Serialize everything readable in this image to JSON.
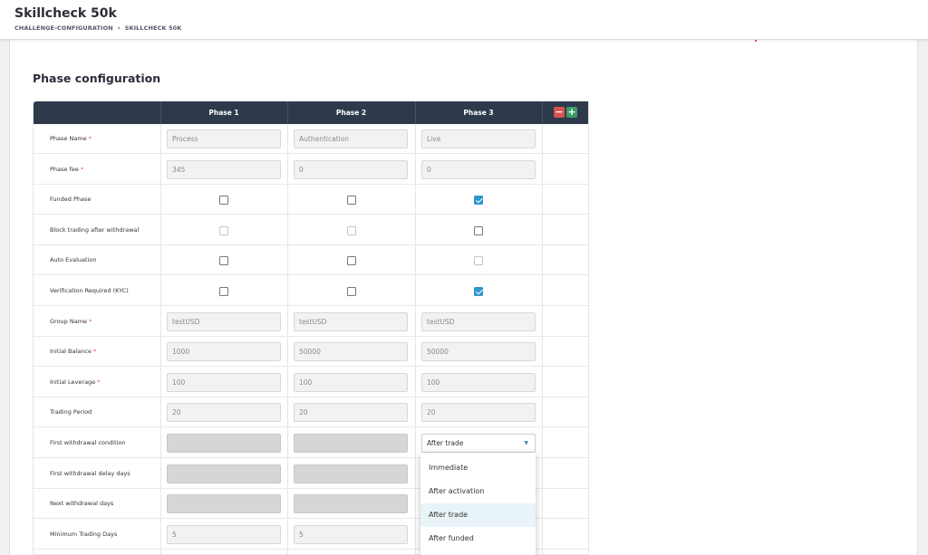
{
  "header": {
    "title": "Skillcheck 50k",
    "breadcrumb": [
      "CHALLENGE-CONFIGURATION",
      "SKILLCHECK 50K"
    ],
    "breadcrumb_sep": "›"
  },
  "section": {
    "title": "Phase configuration"
  },
  "table": {
    "columns": [
      "Phase 1",
      "Phase 2",
      "Phase 3"
    ],
    "minus_label": "−",
    "plus_label": "+",
    "rows": [
      {
        "label": "Phase Name",
        "required": true,
        "type": "text",
        "values": [
          "Process",
          "Authentication",
          "Live"
        ]
      },
      {
        "label": "Phase fee",
        "required": true,
        "type": "text",
        "values": [
          "345",
          "0",
          "0"
        ]
      },
      {
        "label": "Funded Phase",
        "required": false,
        "type": "checkbox",
        "checked": [
          false,
          false,
          true
        ],
        "dim": [
          false,
          false,
          false
        ]
      },
      {
        "label": "Block trading after withdrawal",
        "required": false,
        "type": "checkbox",
        "checked": [
          false,
          false,
          false
        ],
        "dim": [
          true,
          true,
          false
        ]
      },
      {
        "label": "Auto Evaluation",
        "required": false,
        "type": "checkbox",
        "checked": [
          false,
          false,
          false
        ],
        "dim": [
          false,
          false,
          true
        ]
      },
      {
        "label": "Verification Required (KYC)",
        "required": false,
        "type": "checkbox",
        "checked": [
          false,
          false,
          true
        ],
        "dim": [
          false,
          false,
          false
        ]
      },
      {
        "label": "Group Name",
        "required": true,
        "type": "text",
        "values": [
          "testUSD",
          "testUSD",
          "testUSD"
        ]
      },
      {
        "label": "Initial Balance",
        "required": true,
        "type": "text",
        "values": [
          "1000",
          "50000",
          "50000"
        ]
      },
      {
        "label": "Initial Leverage",
        "required": true,
        "type": "text",
        "values": [
          "100",
          "100",
          "100"
        ]
      },
      {
        "label": "Trading Period",
        "required": false,
        "type": "text",
        "values": [
          "20",
          "20",
          "20"
        ]
      },
      {
        "label": "First withdrawal condition",
        "required": false,
        "type": "mixed",
        "values": [
          "",
          "",
          "After trade"
        ]
      },
      {
        "label": "First withdrawal delay days",
        "required": false,
        "type": "disabled",
        "values": [
          "",
          "",
          ""
        ]
      },
      {
        "label": "Next withdrawal days",
        "required": false,
        "type": "disabled",
        "values": [
          "",
          "",
          ""
        ]
      },
      {
        "label": "Minimum Trading Days",
        "required": false,
        "type": "text",
        "values": [
          "5",
          "5",
          ""
        ]
      }
    ]
  },
  "dropdown": {
    "options": [
      "Immediate",
      "After activation",
      "After trade",
      "After funded"
    ],
    "highlighted_index": 2
  }
}
